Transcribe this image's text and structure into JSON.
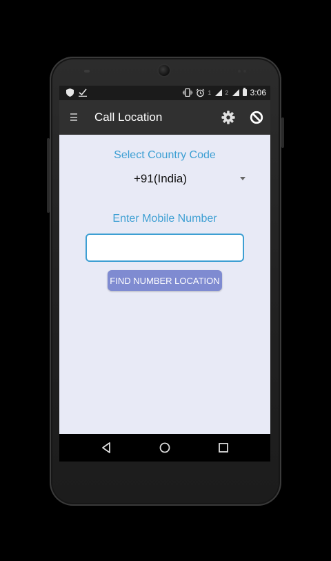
{
  "status_bar": {
    "left_icons": [
      "shield-icon",
      "check-icon"
    ],
    "right_icons": [
      "vibrate-icon",
      "alarm-icon",
      "signal-icon",
      "signal-icon",
      "battery-icon"
    ],
    "sim1": "1",
    "sim2": "2",
    "time": "3:06"
  },
  "app_bar": {
    "title": "Call Location",
    "icons": [
      "menu-icon",
      "gear-icon",
      "block-icon"
    ]
  },
  "form": {
    "country_label": "Select Country Code",
    "country_value": "+91(India)",
    "mobile_label": "Enter Mobile Number",
    "mobile_value": "",
    "mobile_placeholder": "",
    "find_button_label": "FIND NUMBER LOCATION"
  },
  "nav_bar": {
    "icons": [
      "back-icon",
      "home-icon",
      "recents-icon"
    ]
  },
  "colors": {
    "accent": "#3d9fd3",
    "button": "#7f8bd1",
    "background": "#e8eaf6",
    "app_bar": "#303030"
  }
}
